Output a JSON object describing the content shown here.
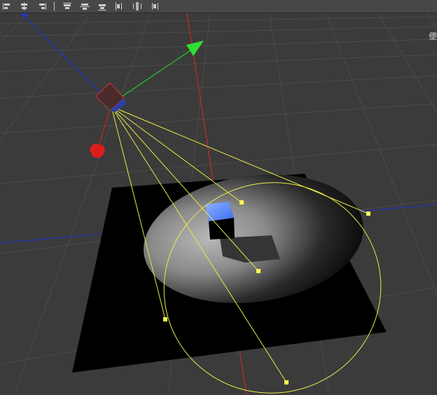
{
  "toolbar": {
    "buttons": [
      {
        "name": "align-left-icon"
      },
      {
        "name": "align-center-horizontal-icon"
      },
      {
        "name": "align-right-icon"
      },
      {
        "name": "align-top-icon"
      },
      {
        "name": "align-middle-vertical-icon"
      },
      {
        "name": "align-bottom-icon"
      },
      {
        "name": "distribute-horizontal-icon"
      },
      {
        "name": "distribute-center-icon"
      },
      {
        "name": "distribute-vertical-icon"
      }
    ]
  },
  "viewport": {
    "corner_label": "便"
  },
  "colors": {
    "background": "#3b3b3b",
    "grid": "#4a4a4a",
    "axis_x": "#2233cc",
    "axis_y": "#cc2222",
    "gizmo_y": "#22cc22",
    "light_gizmo": "#ffff55",
    "ground": "#000000",
    "cube_top": "#5a8cff"
  }
}
